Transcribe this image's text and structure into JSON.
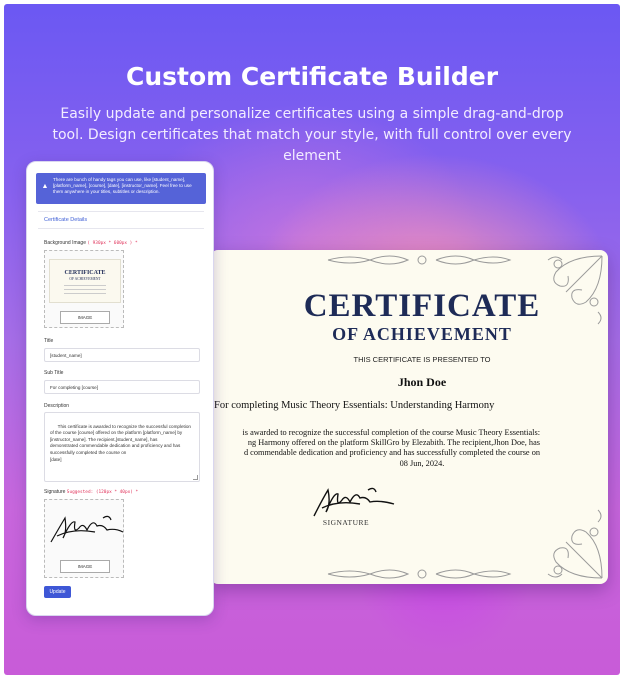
{
  "hero": {
    "title": "Custom Certificate Builder",
    "subtitle": "Easily update and personalize certificates using a simple drag-and-drop tool. Design certificates that match your style, with full control over every element"
  },
  "form": {
    "notice": "There are bunch of handy tags you can use, like [student_name], [platform_name], [course], [date], [instructor_name]. Feel free to use them anywhere in your titles, subtitles or description.",
    "notice_icon": "warning-icon",
    "section_title": "Certificate Details",
    "background_label": "Background Image",
    "background_hint": "( 930px * 600px ) *",
    "image_button": "IMAGE",
    "mini_cert_title": "CERTIFICATE",
    "mini_cert_sub": "OF ACHIEVEMENT",
    "title_label": "Title",
    "title_value": "[student_name]",
    "subtitle_label": "Sub Title",
    "subtitle_value": "For completing [course]",
    "description_label": "Description",
    "description_value": "This certificate is awarded to recognize the successful completion\nof the course [course] offered on the platform [platform_name] by\n[instructor_name]. The recipient,[student_name], has\ndemonstrated commendable dedication and proficiency and has\nsuccessfully completed the course on\n[date]",
    "signature_label": "Signature",
    "signature_hint": "Suggested: (120px * 40px) *",
    "update_button": "Update"
  },
  "certificate": {
    "title": "CERTIFICATE",
    "subtitle": "OF ACHIEVEMENT",
    "presented_to": "THIS CERTIFICATE IS PRESENTED TO",
    "name": "Jhon Doe",
    "course_line": "For completing Music Theory Essentials: Understanding Harmony",
    "description": "is awarded to recognize the successful completion of the course Music Theory Essentials:\nng Harmony offered on the platform SkillGro by Elezabith. The recipient,Jhon Doe, has\nd commendable dedication and proficiency and has successfully completed the course on",
    "date": "08 Jun, 2024.",
    "signature_label": "SIGNATURE"
  },
  "colors": {
    "accent": "#3e57d6",
    "notice_bg": "#5563d8",
    "cert_ink": "#1e2b57"
  }
}
